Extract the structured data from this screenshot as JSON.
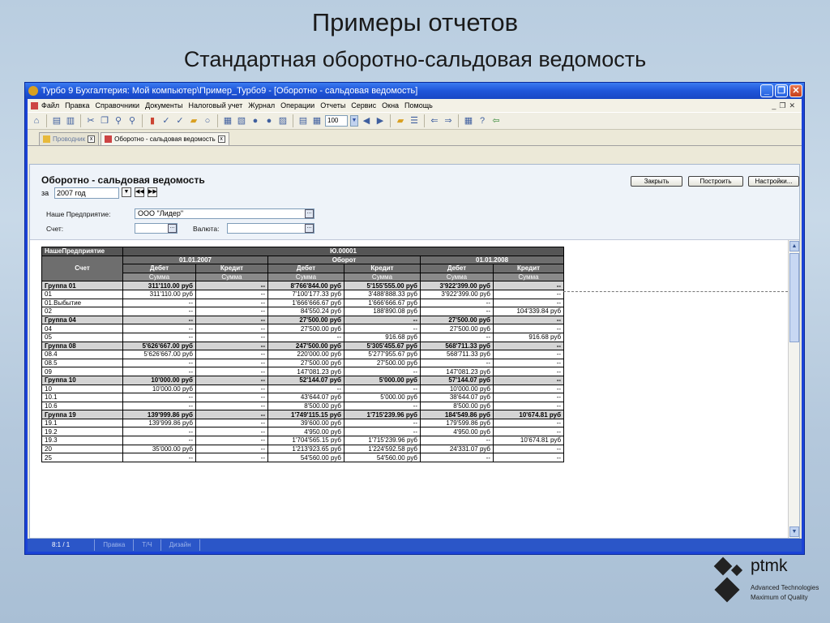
{
  "slide": {
    "title": "Примеры отчетов",
    "subtitle": "Стандартная оборотно-сальдовая ведомость"
  },
  "window": {
    "title": "Турбо 9 Бухгалтерия: Мой компьютер\\Пример_Турбо9 - [Оборотно - сальдовая ведомость]",
    "menu": [
      "Файл",
      "Правка",
      "Справочники",
      "Документы",
      "Налоговый учет",
      "Журнал",
      "Операции",
      "Отчеты",
      "Сервис",
      "Окна",
      "Помощь"
    ],
    "zoom": "100",
    "tabs": [
      "Проводник",
      "Оборотно - сальдовая ведомость"
    ]
  },
  "report": {
    "title": "Оборотно - сальдовая ведомость",
    "period_label": "за",
    "period_value": "2007 год",
    "enterprise_label": "Наше Предприятие:",
    "enterprise_value": "ООО \"Лидер\"",
    "account_label": "Счет:",
    "account_value": "",
    "currency_label": "Валюта:",
    "currency_value": "",
    "buttons": {
      "close": "Закрыть",
      "build": "Построить",
      "settings": "Настройки..."
    }
  },
  "table": {
    "h_enterprise": "НашеПредприятие",
    "h_entity": "Ю.00001",
    "h_account": "Счет",
    "h_date1": "01.01.2007",
    "h_turnover": "Оборот",
    "h_date2": "01.01.2008",
    "h_debit": "Дебет",
    "h_credit": "Кредит",
    "h_sum": "Сумма",
    "rows": [
      {
        "g": true,
        "a": "Группа 01",
        "c": [
          "311'110.00  руб",
          "--",
          "8'766'844.00  руб",
          "5'155'555.00  руб",
          "3'922'399.00  руб",
          "--"
        ]
      },
      {
        "g": false,
        "a": " 01",
        "c": [
          "311'110.00  руб",
          "--",
          "7'100'177.33  руб",
          "3'488'888.33  руб",
          "3'922'399.00  руб",
          "--"
        ]
      },
      {
        "g": false,
        "a": " 01.Выбытие",
        "c": [
          "--",
          "--",
          "1'666'666.67  руб",
          "1'666'666.67  руб",
          "--",
          "--"
        ]
      },
      {
        "g": false,
        "a": "02",
        "c": [
          "--",
          "--",
          "84'550.24  руб",
          "188'890.08  руб",
          "--",
          "104'339.84  руб"
        ]
      },
      {
        "g": true,
        "a": "Группа 04",
        "c": [
          "--",
          "--",
          "27'500.00  руб",
          "--",
          "27'500.00  руб",
          "--"
        ]
      },
      {
        "g": false,
        "a": " 04",
        "c": [
          "--",
          "--",
          "27'500.00  руб",
          "--",
          "27'500.00  руб",
          "--"
        ]
      },
      {
        "g": false,
        "a": "05",
        "c": [
          "--",
          "--",
          "--",
          "916.68  руб",
          "--",
          "916.68  руб"
        ]
      },
      {
        "g": true,
        "a": "Группа 08",
        "c": [
          "5'626'667.00  руб",
          "--",
          "247'500.00  руб",
          "5'305'455.67  руб",
          "568'711.33  руб",
          "--"
        ]
      },
      {
        "g": false,
        "a": " 08.4",
        "c": [
          "5'626'667.00  руб",
          "--",
          "220'000.00  руб",
          "5'277'955.67  руб",
          "568'711.33  руб",
          "--"
        ]
      },
      {
        "g": false,
        "a": " 08.5",
        "c": [
          "--",
          "--",
          "27'500.00  руб",
          "27'500.00  руб",
          "--",
          "--"
        ]
      },
      {
        "g": false,
        "a": "09",
        "c": [
          "--",
          "--",
          "147'081.23  руб",
          "--",
          "147'081.23  руб",
          "--"
        ]
      },
      {
        "g": true,
        "a": "Группа 10",
        "c": [
          "10'000.00  руб",
          "--",
          "52'144.07  руб",
          "5'000.00  руб",
          "57'144.07  руб",
          "--"
        ]
      },
      {
        "g": false,
        "a": " 10",
        "c": [
          "10'000.00  руб",
          "--",
          "--",
          "--",
          "10'000.00  руб",
          "--"
        ]
      },
      {
        "g": false,
        "a": " 10.1",
        "c": [
          "--",
          "--",
          "43'644.07  руб",
          "5'000.00  руб",
          "38'644.07  руб",
          "--"
        ]
      },
      {
        "g": false,
        "a": " 10.6",
        "c": [
          "--",
          "--",
          "8'500.00  руб",
          "--",
          "8'500.00  руб",
          "--"
        ]
      },
      {
        "g": true,
        "a": "Группа 19",
        "c": [
          "139'999.86  руб",
          "--",
          "1'749'115.15  руб",
          "1'715'239.96  руб",
          "184'549.86  руб",
          "10'674.81  руб"
        ]
      },
      {
        "g": false,
        "a": " 19.1",
        "c": [
          "139'999.86  руб",
          "--",
          "39'600.00  руб",
          "--",
          "179'599.86  руб",
          "--"
        ]
      },
      {
        "g": false,
        "a": " 19.2",
        "c": [
          "--",
          "--",
          "4'950.00  руб",
          "--",
          "4'950.00  руб",
          "--"
        ]
      },
      {
        "g": false,
        "a": " 19.3",
        "c": [
          "--",
          "--",
          "1'704'565.15  руб",
          "1'715'239.96  руб",
          "--",
          "10'674.81  руб"
        ]
      },
      {
        "g": false,
        "a": "20",
        "c": [
          "35'000.00  руб",
          "--",
          "1'213'923.65  руб",
          "1'224'592.58  руб",
          "24'331.07  руб",
          "--"
        ]
      },
      {
        "g": false,
        "a": "25",
        "c": [
          "--",
          "--",
          "54'560.00  руб",
          "54'560.00  руб",
          "--",
          "--"
        ]
      }
    ]
  },
  "status": {
    "page": "8:1 / 1",
    "t1": "Правка",
    "t2": "Т/Ч",
    "t3": "Дизайн"
  },
  "logo": {
    "name": "ptmk",
    "line1": "Advanced Technologies",
    "line2": "Maximum of Quality"
  }
}
